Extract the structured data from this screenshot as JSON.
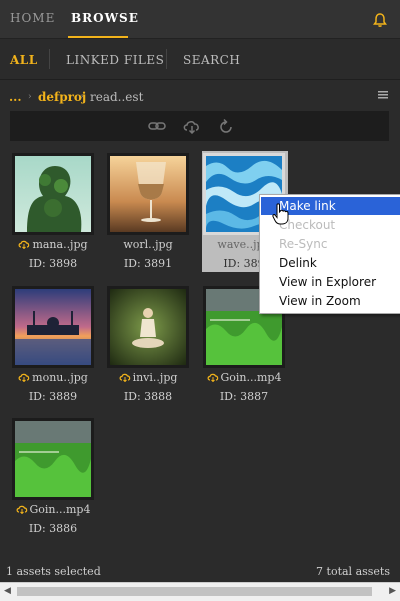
{
  "nav": {
    "home": "HOME",
    "browse": "BROWSE"
  },
  "subnav": {
    "all": "ALL",
    "linked": "LINKED FILES",
    "search": "SEARCH"
  },
  "breadcrumb": {
    "dots": "...",
    "project": "defproj",
    "current": "read..est"
  },
  "assets": [
    {
      "name": "mana..jpg",
      "id": "ID: 3898"
    },
    {
      "name": "worl..jpg",
      "id": "ID: 3891"
    },
    {
      "name": "wave..jpg",
      "id": "ID: 389"
    },
    {
      "name": "monu..jpg",
      "id": "ID: 3889"
    },
    {
      "name": "invi..jpg",
      "id": "ID: 3888"
    },
    {
      "name": "Goin...mp4",
      "id": "ID: 3887"
    },
    {
      "name": "Goin...mp4",
      "id": "ID: 3886"
    }
  ],
  "context_menu": [
    "Make link",
    "Checkout",
    "Re-Sync",
    "Delink",
    "View in Explorer",
    "View in Zoom"
  ],
  "status": {
    "selected": "1 assets selected",
    "total": "7 total assets"
  },
  "colors": {
    "accent": "#f2b31b",
    "menu_highlight": "#2a63d8"
  },
  "icons": [
    "bell-icon",
    "link-icon",
    "cloud-download-icon",
    "refresh-icon",
    "cloud-icon",
    "menu-icon"
  ]
}
